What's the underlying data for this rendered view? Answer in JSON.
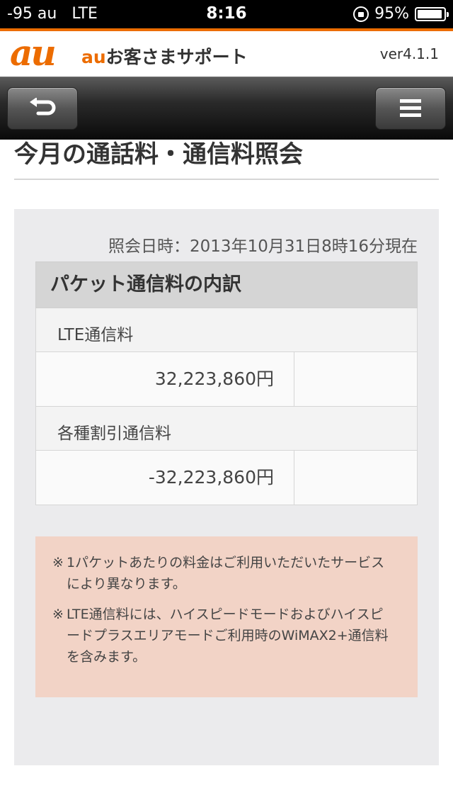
{
  "status_bar": {
    "carrier": "-95 au",
    "network": "LTE",
    "time": "8:16",
    "battery": "95%",
    "battery_level": 0.95
  },
  "header": {
    "logo": "au",
    "title_prefix": "au",
    "title": "お客さまサポート",
    "version": "ver4.1.1"
  },
  "toolbar": {
    "back_icon": "back-arrow-icon",
    "menu_icon": "hamburger-menu-icon"
  },
  "page": {
    "title": "今月の通話料・通信料照会"
  },
  "content": {
    "query_date": "照会日時：2013年10月31日8時16分現在",
    "table": {
      "heading": "パケット通信料の内訳",
      "rows": [
        {
          "label": "LTE通信料",
          "value": "32,223,860円"
        },
        {
          "label": "各種割引通信料",
          "value": "-32,223,860円"
        }
      ]
    },
    "notes": [
      {
        "mark": "※",
        "text": "1パケットあたりの料金はご利用いただいたサービスにより異なります。"
      },
      {
        "mark": "※",
        "text": "LTE通信料には、ハイスピードモードおよびハイスピードプラスエリアモードご利用時のWiMAX2+通信料を含みます。"
      }
    ]
  },
  "colors": {
    "brand_orange": "#ec6c00",
    "note_background": "#f2d3c6",
    "panel_background": "#ebebed"
  }
}
